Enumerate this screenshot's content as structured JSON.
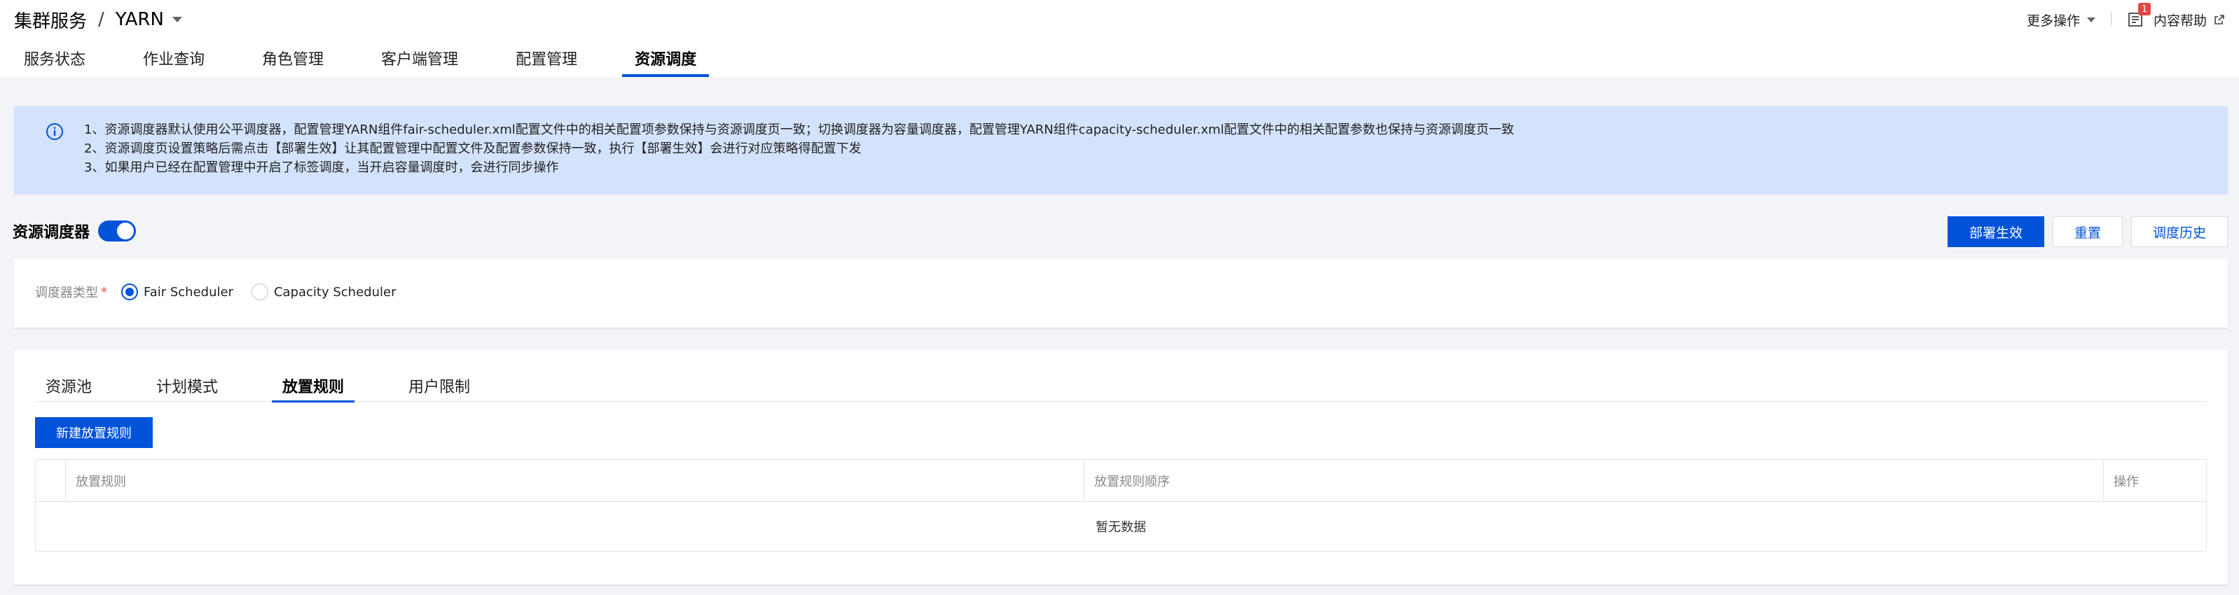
{
  "breadcrumb": {
    "parent": "集群服务",
    "separator": "/",
    "current": "YARN"
  },
  "top_actions": {
    "more_label": "更多操作",
    "badge_count": "1",
    "help_label": "内容帮助"
  },
  "tabs": [
    {
      "label": "服务状态",
      "active": false
    },
    {
      "label": "作业查询",
      "active": false
    },
    {
      "label": "角色管理",
      "active": false
    },
    {
      "label": "客户端管理",
      "active": false
    },
    {
      "label": "配置管理",
      "active": false
    },
    {
      "label": "资源调度",
      "active": true
    }
  ],
  "notice": {
    "lines": [
      "1、资源调度器默认使用公平调度器，配置管理YARN组件fair-scheduler.xml配置文件中的相关配置项参数保持与资源调度页一致；切换调度器为容量调度器，配置管理YARN组件capacity-scheduler.xml配置文件中的相关配置参数也保持与资源调度页一致",
      "2、资源调度页设置策略后需点击【部署生效】让其配置管理中配置文件及配置参数保持一致，执行【部署生效】会进行对应策略得配置下发",
      "3、如果用户已经在配置管理中开启了标签调度，当开启容量调度时，会进行同步操作"
    ]
  },
  "scheduler": {
    "title": "资源调度器",
    "enabled": true,
    "buttons": {
      "deploy": "部署生效",
      "reset": "重置",
      "history": "调度历史"
    },
    "type_label": "调度器类型",
    "required_mark": "*",
    "options": [
      {
        "label": "Fair Scheduler",
        "checked": true
      },
      {
        "label": "Capacity Scheduler",
        "checked": false
      }
    ]
  },
  "rules": {
    "subtabs": [
      {
        "label": "资源池",
        "active": false
      },
      {
        "label": "计划模式",
        "active": false
      },
      {
        "label": "放置规则",
        "active": true
      },
      {
        "label": "用户限制",
        "active": false
      }
    ],
    "new_button": "新建放置规则",
    "columns": [
      "放置规则",
      "放置规则顺序",
      "操作"
    ],
    "empty_text": "暂无数据"
  },
  "colors": {
    "accent": "#0052d9",
    "notice_bg": "#d4e3fc",
    "badge": "#e54545"
  }
}
